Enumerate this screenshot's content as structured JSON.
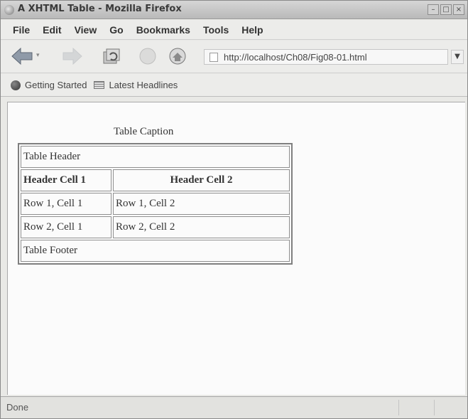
{
  "window": {
    "title": "A XHTML Table - Mozilla Firefox",
    "controls": [
      "minimize-icon",
      "maximize-icon",
      "close-icon"
    ]
  },
  "menu": [
    "File",
    "Edit",
    "View",
    "Go",
    "Bookmarks",
    "Tools",
    "Help"
  ],
  "toolbar": {
    "icons": [
      "back-arrow-icon",
      "forward-arrow-icon",
      "reload-icon",
      "stop-icon",
      "home-icon"
    ],
    "url": "http://localhost/Ch08/Fig08-01.html"
  },
  "bookmarks": {
    "items": [
      {
        "label": "Getting Started",
        "icon": "getting-started-icon"
      },
      {
        "label": "Latest Headlines",
        "icon": "rss-feed-icon"
      }
    ]
  },
  "page": {
    "caption": "Table Caption",
    "table": {
      "header": "Table Header",
      "columns": [
        "Header Cell 1",
        "Header Cell 2"
      ],
      "rows": [
        [
          "Row 1, Cell 1",
          "Row 1, Cell 2"
        ],
        [
          "Row 2, Cell 1",
          "Row 2, Cell 2"
        ]
      ],
      "footer": "Table Footer"
    }
  },
  "status": {
    "text": "Done"
  }
}
